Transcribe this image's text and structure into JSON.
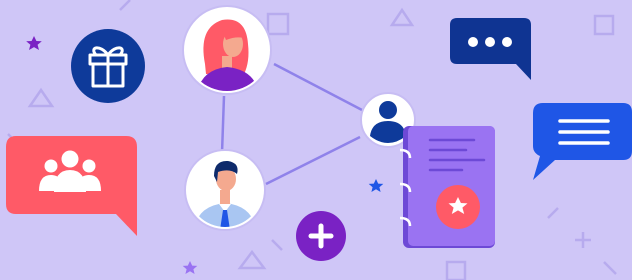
{
  "colors": {
    "background": "#cfc6f7",
    "deco": "#b7abee",
    "connector": "#8f82ea",
    "navy": "#0e3a9a",
    "navy_bubble": "#0f3492",
    "blue_bubble": "#1f56e6",
    "coral": "#ff5a67",
    "purple": "#7a22c4",
    "notebook": "#9a73f2",
    "notebook_spine": "#6d49d6",
    "white": "#ffffff"
  },
  "icons": {
    "gift": "gift-icon",
    "group": "group-icon",
    "user": "user-icon",
    "plus": "plus-icon",
    "star": "star-icon",
    "chat_typing": "typing-dots-icon",
    "chat_lines": "message-lines-icon",
    "notebook": "notebook-icon"
  }
}
